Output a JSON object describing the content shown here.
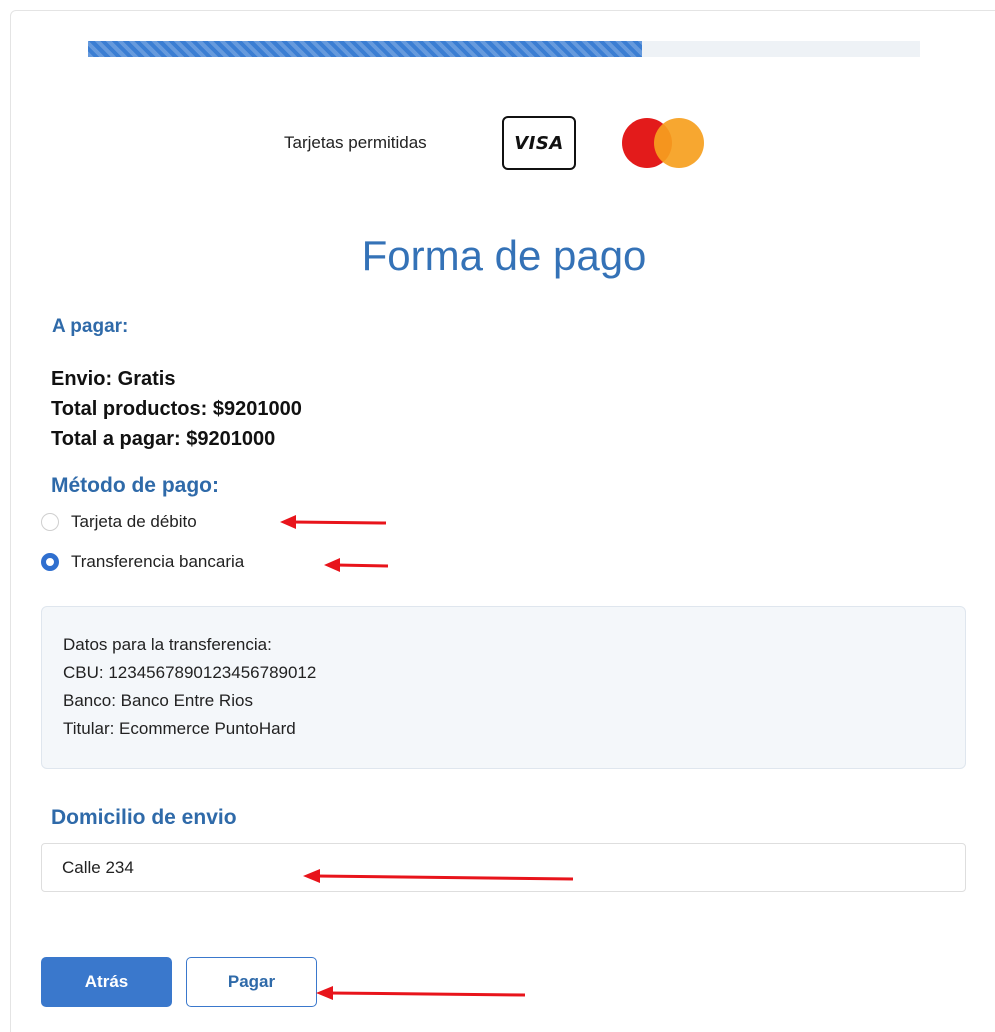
{
  "progress": {
    "value_percent": 66.6,
    "color": "#3b7ed3"
  },
  "cards": {
    "label": "Tarjetas permitidas",
    "visa_text": "VISA",
    "brands": [
      "visa",
      "mastercard"
    ]
  },
  "title": "Forma de pago",
  "payment_summary": {
    "heading": "A pagar:",
    "shipping": "Envio: Gratis",
    "products_total": "Total productos: $9201000",
    "grand_total": "Total a pagar: $9201000"
  },
  "method": {
    "heading": "Método de pago:",
    "options": [
      {
        "label": "Tarjeta de débito",
        "selected": false
      },
      {
        "label": "Transferencia bancaria",
        "selected": true
      }
    ]
  },
  "transfer_info": {
    "title": "Datos para la transferencia:",
    "cbu": "CBU: 1234567890123456789012",
    "bank": "Banco: Banco Entre Rios",
    "holder": "Titular: Ecommerce PuntoHard"
  },
  "address": {
    "heading": "Domicilio de envio",
    "value": "Calle 234"
  },
  "buttons": {
    "back": "Atrás",
    "pay": "Pagar"
  },
  "colors": {
    "accent": "#2f6aa9",
    "annotation_arrow": "#e8141b"
  }
}
